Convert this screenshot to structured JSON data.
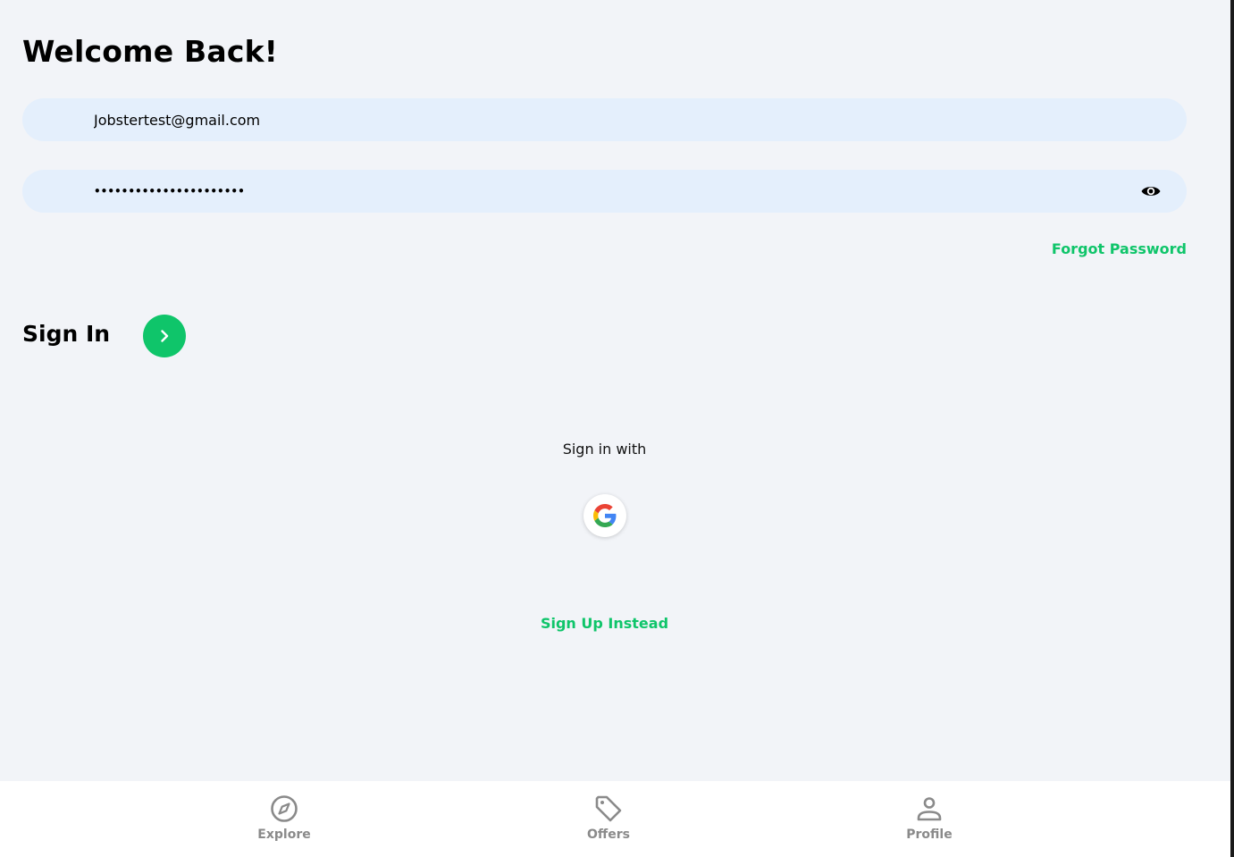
{
  "header": {
    "title": "Welcome Back!"
  },
  "form": {
    "email_value": "Jobstertest@gmail.com",
    "password_value": "••••••••••••••••••••••",
    "forgot_label": "Forgot Password",
    "signin_label": "Sign In"
  },
  "social": {
    "heading": "Sign in with",
    "providers": [
      {
        "name": "google",
        "icon": "google-icon"
      }
    ]
  },
  "signup_label": "Sign Up Instead",
  "bottom_nav": {
    "items": [
      {
        "label": "Explore",
        "icon": "compass-icon"
      },
      {
        "label": "Offers",
        "icon": "tag-icon"
      },
      {
        "label": "Profile",
        "icon": "user-icon"
      }
    ]
  },
  "colors": {
    "accent": "#0fc56a",
    "background": "#f2f4f8",
    "field_background": "#e4effc",
    "nav_inactive": "#8a8a8a"
  }
}
